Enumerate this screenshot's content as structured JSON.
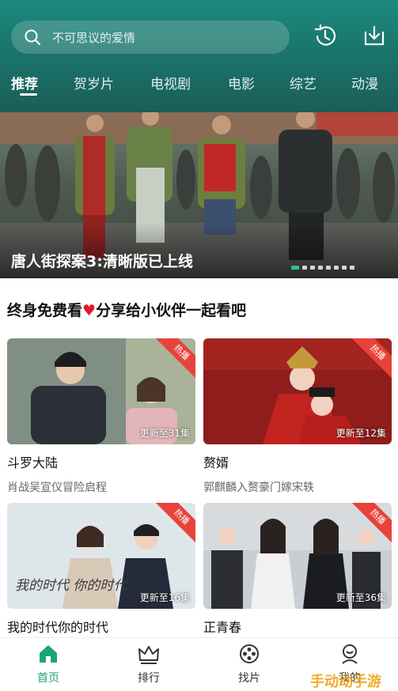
{
  "header": {
    "search": {
      "placeholder": "不可思议的爱情"
    },
    "tabs": [
      {
        "label": "推荐",
        "active": true
      },
      {
        "label": "贺岁片"
      },
      {
        "label": "电视剧"
      },
      {
        "label": "电影"
      },
      {
        "label": "综艺"
      },
      {
        "label": "动漫"
      }
    ]
  },
  "banner": {
    "title": "唐人街探案3:清晰版已上线",
    "slide_count": 8,
    "active_slide": 1
  },
  "promo": {
    "text_before": "终身免费看",
    "heart": "♥",
    "text_after": "分享给小伙伴一起看吧"
  },
  "cards": [
    {
      "badge": "热播",
      "episodes": "更新至31集",
      "title": "斗罗大陆",
      "subtitle": "肖战吴宣仪冒险启程"
    },
    {
      "badge": "热播",
      "episodes": "更新至12集",
      "title": "赘婿",
      "subtitle": "郭麒麟入赘豪门嫁宋轶"
    },
    {
      "badge": "热播",
      "episodes": "更新至16集",
      "title": "我的时代你的时代",
      "subtitle": "",
      "poster_text": "我的时代 你的时代"
    },
    {
      "badge": "热播",
      "episodes": "更新至36集",
      "title": "正青春",
      "subtitle": ""
    }
  ],
  "bottom_nav": [
    {
      "label": "首页",
      "icon": "home-icon",
      "active": true
    },
    {
      "label": "排行",
      "icon": "crown-icon"
    },
    {
      "label": "找片",
      "icon": "film-reel-icon"
    },
    {
      "label": "我的",
      "icon": "user-icon"
    }
  ],
  "watermark": "手动动手游",
  "colors": {
    "header": "#1a6f66",
    "accent": "#1aa57d",
    "badge": "#e8423a"
  }
}
